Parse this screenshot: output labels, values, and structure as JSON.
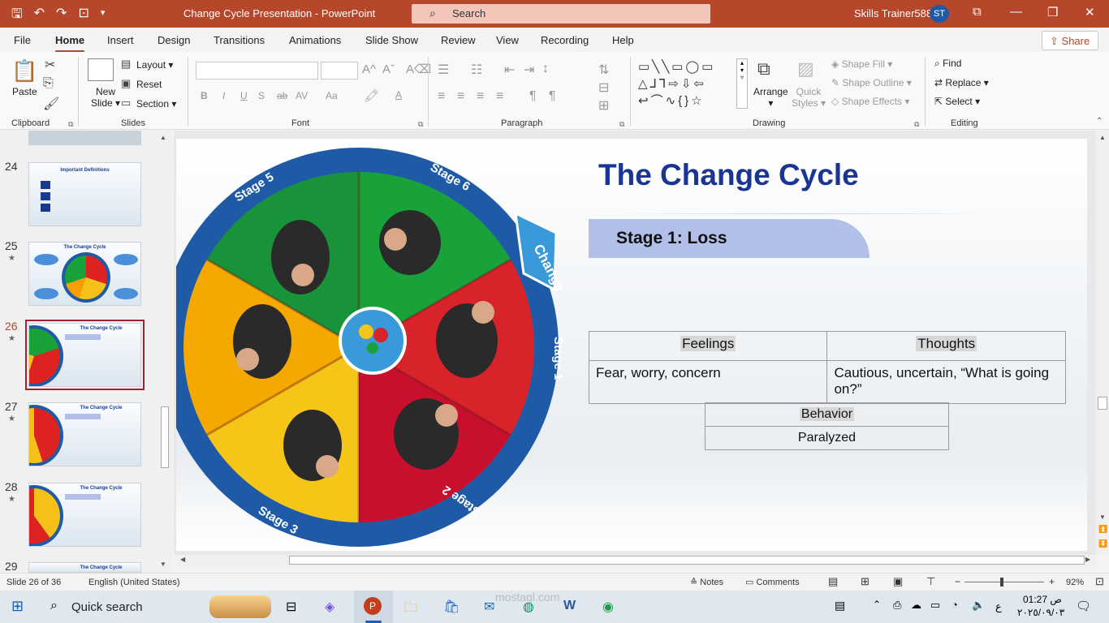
{
  "titlebar": {
    "title": "Change Cycle Presentation  -  PowerPoint",
    "search_placeholder": "Search",
    "user": "Skills Trainer588",
    "avatar": "ST",
    "qat_icons": [
      "save-icon",
      "undo-icon",
      "redo-icon",
      "present-icon",
      "customize-icon"
    ]
  },
  "menu": {
    "tabs": [
      "File",
      "Home",
      "Insert",
      "Design",
      "Transitions",
      "Animations",
      "Slide Show",
      "Review",
      "View",
      "Recording",
      "Help"
    ],
    "active": "Home",
    "share": "Share"
  },
  "ribbon": {
    "clipboard": {
      "label": "Clipboard",
      "paste": "Paste"
    },
    "slides": {
      "label": "Slides",
      "new_slide_1": "New",
      "new_slide_2": "Slide",
      "layout": "Layout",
      "reset": "Reset",
      "section": "Section"
    },
    "font": {
      "label": "Font",
      "buttons": [
        "B",
        "I",
        "U",
        "S",
        "ab",
        "AV",
        "Aa",
        "A"
      ]
    },
    "paragraph": {
      "label": "Paragraph"
    },
    "drawing": {
      "label": "Drawing",
      "arrange": "Arrange",
      "quick_styles_1": "Quick",
      "quick_styles_2": "Styles",
      "shape_fill": "Shape Fill",
      "shape_outline": "Shape Outline",
      "shape_effects": "Shape Effects"
    },
    "editing": {
      "label": "Editing",
      "find": "Find",
      "replace": "Replace",
      "select": "Select"
    }
  },
  "thumbnails": [
    {
      "num": "24",
      "title": "Important Definitions",
      "starred": false,
      "selected": false
    },
    {
      "num": "25",
      "title": "The Change Cycle",
      "starred": true,
      "selected": false
    },
    {
      "num": "26",
      "title": "The Change Cycle",
      "starred": true,
      "selected": true
    },
    {
      "num": "27",
      "title": "The Change Cycle",
      "starred": true,
      "selected": false
    },
    {
      "num": "28",
      "title": "The Change Cycle",
      "starred": true,
      "selected": false
    },
    {
      "num": "29",
      "title": "The Change Cycle",
      "starred": false,
      "selected": false
    }
  ],
  "slide": {
    "title": "The Change Cycle",
    "stage_banner": "Stage 1: Loss",
    "wheel_labels": [
      "Stage 1",
      "Stage 2",
      "Stage 3",
      "Stage 5",
      "Stage 6",
      "Change"
    ],
    "table": {
      "headers": [
        "Feelings",
        "Thoughts"
      ],
      "row": [
        "Fear, worry, concern",
        "Cautious, uncertain, “What is going on?”"
      ]
    },
    "behavior": {
      "header": "Behavior",
      "value": "Paralyzed"
    }
  },
  "status": {
    "slide_info": "Slide 26 of 36",
    "language": "English (United States)",
    "notes": "Notes",
    "comments": "Comments",
    "zoom": "92%"
  },
  "taskbar": {
    "search": "Quick search",
    "time": "01:27 ص",
    "date": "٢٠٢٥/٠٩/٠٣",
    "lang": "ع",
    "watermark": "mostaql.com"
  },
  "colors": {
    "accent": "#b7472a",
    "title_blue": "#1a3592",
    "banner": "#b1bfe9",
    "selected_thumb": "#9b2230"
  }
}
